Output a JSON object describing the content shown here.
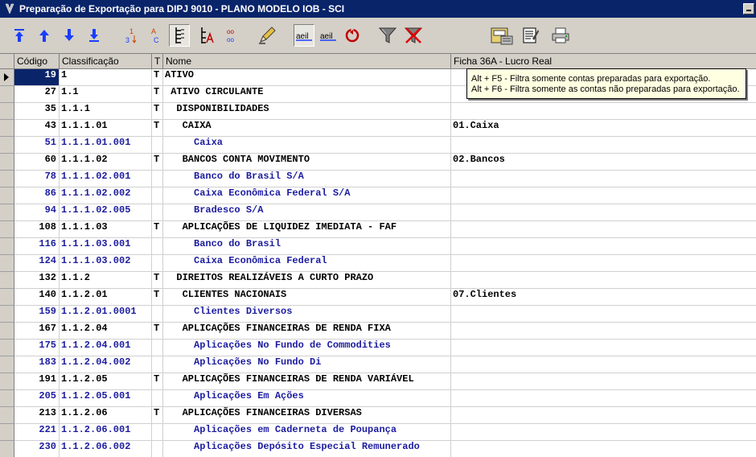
{
  "window": {
    "title": "Preparação de Exportação para DIPJ 9010 - PLANO MODELO IOB - SCI"
  },
  "toolbar": {
    "buttons": [
      {
        "name": "first-record-button",
        "icon": "double-up-arrow-icon"
      },
      {
        "name": "prior-record-button",
        "icon": "up-arrow-icon"
      },
      {
        "name": "next-record-button",
        "icon": "down-arrow-icon"
      },
      {
        "name": "last-record-button",
        "icon": "double-down-arrow-icon"
      },
      {
        "name": "sort-numeric-button",
        "icon": "sort-numeric-icon"
      },
      {
        "name": "sort-alpha-button",
        "icon": "sort-alpha-icon"
      },
      {
        "name": "tree-view-button",
        "icon": "tree-icon"
      },
      {
        "name": "tree-text-button",
        "icon": "tree-text-icon"
      },
      {
        "name": "toggle-button",
        "icon": "toggle-icon"
      },
      {
        "name": "edit-button",
        "icon": "pencil-icon"
      },
      {
        "name": "text-case-button",
        "icon": "text-aeil-icon"
      },
      {
        "name": "text-case-alt-button",
        "icon": "text-aeil-alt-icon"
      },
      {
        "name": "refresh-button",
        "icon": "refresh-icon"
      },
      {
        "name": "filter-button",
        "icon": "filter-icon"
      },
      {
        "name": "remove-filter-button",
        "icon": "filter-remove-icon"
      },
      {
        "name": "export-button",
        "icon": "export-icon"
      },
      {
        "name": "report-button",
        "icon": "report-icon"
      },
      {
        "name": "print-button",
        "icon": "printer-icon"
      }
    ],
    "labels": {
      "sort_num_top": "1",
      "sort_num_bottom": "3",
      "sort_alpha_top": "A",
      "sort_alpha_bottom": "C",
      "text_aeil": "aeil",
      "text_aeil2": "aeil",
      "toggle_top": "oo",
      "toggle_bottom": "oo"
    }
  },
  "grid": {
    "columns": {
      "code": "Código",
      "classification": "Classificação",
      "type": "T",
      "name": "Nome",
      "ficha": "Ficha 36A - Lucro Real"
    },
    "rows": [
      {
        "code": "19",
        "class": "1",
        "t": "T",
        "name": "ATIVO",
        "ficha": "",
        "kind": "synth",
        "selected": true
      },
      {
        "code": "27",
        "class": "1.1",
        "t": "T",
        "name": " ATIVO CIRCULANTE",
        "ficha": "",
        "kind": "synth"
      },
      {
        "code": "35",
        "class": "1.1.1",
        "t": "T",
        "name": "  DISPONIBILIDADES",
        "ficha": "",
        "kind": "synth"
      },
      {
        "code": "43",
        "class": "1.1.1.01",
        "t": "T",
        "name": "   CAIXA",
        "ficha": "01.Caixa",
        "kind": "synth"
      },
      {
        "code": "51",
        "class": "1.1.1.01.001",
        "t": "",
        "name": "     Caixa",
        "ficha": "",
        "kind": "anal"
      },
      {
        "code": "60",
        "class": "1.1.1.02",
        "t": "T",
        "name": "   BANCOS CONTA MOVIMENTO",
        "ficha": "02.Bancos",
        "kind": "synth"
      },
      {
        "code": "78",
        "class": "1.1.1.02.001",
        "t": "",
        "name": "     Banco do Brasil S/A",
        "ficha": "",
        "kind": "anal"
      },
      {
        "code": "86",
        "class": "1.1.1.02.002",
        "t": "",
        "name": "     Caixa Econômica Federal S/A",
        "ficha": "",
        "kind": "anal"
      },
      {
        "code": "94",
        "class": "1.1.1.02.005",
        "t": "",
        "name": "     Bradesco S/A",
        "ficha": "",
        "kind": "anal"
      },
      {
        "code": "108",
        "class": "1.1.1.03",
        "t": "T",
        "name": "   APLICAÇÕES DE LIQUIDEZ IMEDIATA - FAF",
        "ficha": "",
        "kind": "synth"
      },
      {
        "code": "116",
        "class": "1.1.1.03.001",
        "t": "",
        "name": "     Banco do Brasil",
        "ficha": "",
        "kind": "anal"
      },
      {
        "code": "124",
        "class": "1.1.1.03.002",
        "t": "",
        "name": "     Caixa Econômica Federal",
        "ficha": "",
        "kind": "anal"
      },
      {
        "code": "132",
        "class": "1.1.2",
        "t": "T",
        "name": "  DIREITOS REALIZÁVEIS A CURTO PRAZO",
        "ficha": "",
        "kind": "synth"
      },
      {
        "code": "140",
        "class": "1.1.2.01",
        "t": "T",
        "name": "   CLIENTES NACIONAIS",
        "ficha": "07.Clientes",
        "kind": "synth"
      },
      {
        "code": "159",
        "class": "1.1.2.01.0001",
        "t": "",
        "name": "     Clientes Diversos",
        "ficha": "",
        "kind": "anal"
      },
      {
        "code": "167",
        "class": "1.1.2.04",
        "t": "T",
        "name": "   APLICAÇÕES FINANCEIRAS DE RENDA FIXA",
        "ficha": "",
        "kind": "synth"
      },
      {
        "code": "175",
        "class": "1.1.2.04.001",
        "t": "",
        "name": "     Aplicações No Fundo de Commodities",
        "ficha": "",
        "kind": "anal"
      },
      {
        "code": "183",
        "class": "1.1.2.04.002",
        "t": "",
        "name": "     Aplicações No Fundo Di",
        "ficha": "",
        "kind": "anal"
      },
      {
        "code": "191",
        "class": "1.1.2.05",
        "t": "T",
        "name": "   APLICAÇÕES FINANCEIRAS DE RENDA VARIÁVEL",
        "ficha": "",
        "kind": "synth"
      },
      {
        "code": "205",
        "class": "1.1.2.05.001",
        "t": "",
        "name": "     Aplicações Em Ações",
        "ficha": "",
        "kind": "anal"
      },
      {
        "code": "213",
        "class": "1.1.2.06",
        "t": "T",
        "name": "   APLICAÇÕES FINANCEIRAS DIVERSAS",
        "ficha": "",
        "kind": "synth"
      },
      {
        "code": "221",
        "class": "1.1.2.06.001",
        "t": "",
        "name": "     Aplicações em Caderneta de Poupança",
        "ficha": "",
        "kind": "anal"
      },
      {
        "code": "230",
        "class": "1.1.2.06.002",
        "t": "",
        "name": "     Aplicações Depósito Especial Remunerado",
        "ficha": "",
        "kind": "anal"
      }
    ]
  },
  "tooltip": {
    "line1": "Alt + F5 - Filtra somente contas preparadas para exportação.",
    "line2": "Alt + F6 - Filtra somente as contas não preparadas para exportação."
  },
  "colors": {
    "titlebar": "#0a246a",
    "synthetic_text": "#000000",
    "analytic_text": "#1c1ca0",
    "tooltip_bg": "#ffffe1"
  }
}
